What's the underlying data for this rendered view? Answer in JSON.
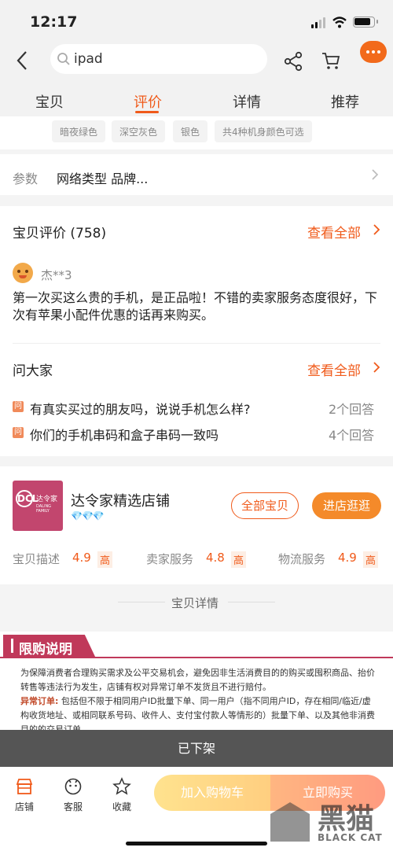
{
  "status_bar": {
    "time": "12:17"
  },
  "search": {
    "value": "ipad"
  },
  "tabs": [
    {
      "label": "宝贝"
    },
    {
      "label": "评价"
    },
    {
      "label": "详情"
    },
    {
      "label": "推荐"
    }
  ],
  "colors": {
    "accent": "#f05a1a",
    "button_orange": "#f48a2a",
    "buy_red": "#ff4a1a",
    "cart_yellow": "#ffb31a",
    "limit_banner": "#c0395a"
  },
  "color_chips": [
    "暗夜绿色",
    "深空灰色",
    "银色",
    "共4种机身颜色可选"
  ],
  "params": {
    "label": "参数",
    "value": "网络类型 品牌..."
  },
  "reviews": {
    "title": "宝贝评价 (758)",
    "view_all": "查看全部",
    "user": "杰**3",
    "text": "第一次买这么贵的手机，是正品啦！不错的卖家服务态度很好，下次有苹果小配件优惠的话再来购买。"
  },
  "ask": {
    "title": "问大家",
    "view_all": "查看全部",
    "icon_char": "问",
    "questions": [
      {
        "q": "有真实买过的朋友吗，说说手机怎么样?",
        "count": "2个回答"
      },
      {
        "q": "你们的手机串码和盒子串码一致吗",
        "count": "4个回答"
      }
    ]
  },
  "shop": {
    "logo_letters": "DCL",
    "logo_cn": "达令家",
    "logo_en": "DALING FAMILY",
    "name": "达令家精选店铺",
    "all_items": "全部宝贝",
    "enter": "进店逛逛",
    "ratings": [
      {
        "label": "宝贝描述",
        "score": "4.9",
        "level": "高"
      },
      {
        "label": "卖家服务",
        "score": "4.8",
        "level": "高"
      },
      {
        "label": "物流服务",
        "score": "4.9",
        "level": "高"
      }
    ]
  },
  "detail_divider": "宝贝详情",
  "limit": {
    "title": "限购说明",
    "para1": "为保障消费者合理购买需求及公平交易机会，避免因非生活消费目的的购买或囤积商品、抬价转售等违法行为发生，店铺有权对异常订单不发货且不进行赔付。",
    "abnormal_label": "异常订单:",
    "para2": "包括但不限于相同用户ID批量下单、同一用户（指不同用户ID，存在相同/临近/虚构收货地址、或相同联系号码、收件人、支付宝付款人等情形的）批量下单、以及其他非消费目的的交易订单。"
  },
  "off_shelf": "已下架",
  "bottom": {
    "shop": "店铺",
    "service": "客服",
    "favorite": "收藏",
    "add_cart": "加入购物车",
    "buy_now": "立即购买"
  },
  "watermark": {
    "cn": "黑猫",
    "en": "BLACK CAT"
  }
}
